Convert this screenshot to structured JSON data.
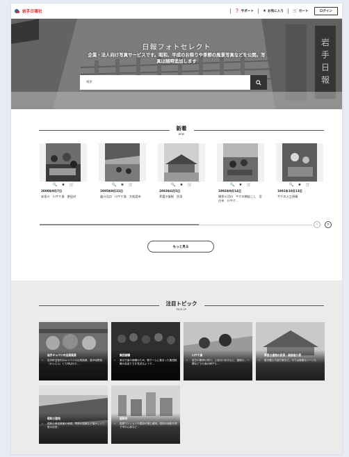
{
  "header": {
    "logo_text": "岩手日報社",
    "nav": [
      {
        "label": "サポート",
        "icon": "question-circle-icon"
      },
      {
        "label": "お気に入り",
        "icon": "star-icon"
      },
      {
        "label": "カート",
        "icon": "cart-icon"
      }
    ],
    "login_label": "ログイン"
  },
  "hero": {
    "title": "日報フォトセレクト",
    "subtitle": "企業・法人向け写真サービスです。昭和、平成のお祭りや季節の風景写真などを公開。写真は随時追加します",
    "search_placeholder": "検索",
    "search_icon": "search-icon"
  },
  "new_section": {
    "title": "新着",
    "title_en": "NEW",
    "cards": [
      {
        "date": "2000年9月7日",
        "caption": "安家川　川サケ漁　野田村"
      },
      {
        "date": "1995年9月22日",
        "caption": "盛川河口　川サケ漁　大船渡市"
      },
      {
        "date": "1993年6月5日",
        "caption": "茅葺き屋根　民家"
      },
      {
        "date": "1992年9月14日",
        "caption": "閉伊川河口　サケの網起こし　宮古市　川サケ…"
      },
      {
        "date": "1991年10月13日",
        "caption": "サケの人工授精"
      }
    ],
    "card_icons": [
      "zoom-icon",
      "star-icon",
      "cart-icon"
    ],
    "more_label": "もっと見る",
    "prev_icon": "chevron-left-icon",
    "next_icon": "chevron-right-icon"
  },
  "pickup_section": {
    "title": "注目トピック",
    "title_en": "PICK UP",
    "topics": [
      {
        "title": "岩手キャベツの出荷風景",
        "desc": "岩手町沼宮内のキャベツの出荷風景。高冷地野菜（かんらん）とも呼ばれた…"
      },
      {
        "title": "集団就職",
        "desc": "東京方面の就職のため、駅ホームに集まった集団就職の若者たちを見送るようす…"
      },
      {
        "title": "川サケ漁",
        "desc": "宮古の閉伊川河口、上流の川を中心に、盛岡川、一関などでの漁の様子も…"
      },
      {
        "title": "茅葺き屋根の民家・南部曲り家",
        "desc": "葺き替えや曲り家など、今では貴重なシーンも"
      },
      {
        "title": "昭和三陸地",
        "desc": "昭和の津波被害の地域、季節の風景など懐かしい三陸の自然…"
      },
      {
        "title": "盛岡市",
        "desc": "高層マンションや建設が進む盛岡。昭和の面影を残す市中心部など…"
      }
    ]
  }
}
